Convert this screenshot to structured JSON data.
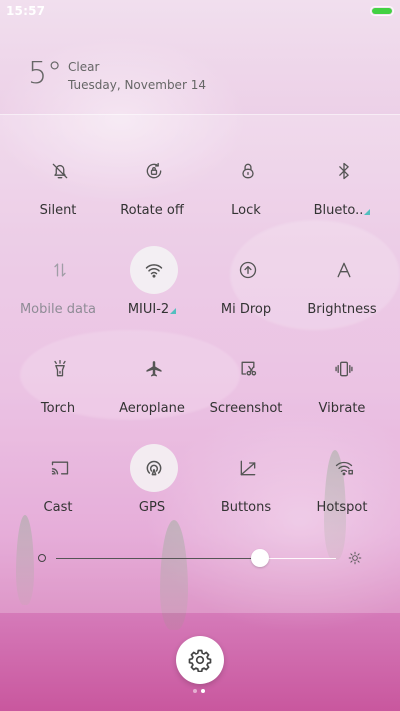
{
  "status_bar": {
    "time": "15:57",
    "battery_level": 1.0,
    "battery_color": "#43d143"
  },
  "weather": {
    "temperature": "5°",
    "condition": "Clear",
    "date": "Tuesday, November 14"
  },
  "tiles": [
    {
      "label": "Silent",
      "icon": "bell-off-icon",
      "active": false,
      "disabled": false
    },
    {
      "label": "Rotate off",
      "icon": "rotate-lock-icon",
      "active": false,
      "disabled": false
    },
    {
      "label": "Lock",
      "icon": "lock-icon",
      "active": false,
      "disabled": false
    },
    {
      "label": "Blueto..",
      "icon": "bluetooth-icon",
      "active": false,
      "disabled": false,
      "has_more": true
    },
    {
      "label": "Mobile data",
      "icon": "mobile-data-icon",
      "active": false,
      "disabled": true
    },
    {
      "label": "MIUI-2",
      "icon": "wifi-icon",
      "active": true,
      "disabled": false,
      "has_more": true
    },
    {
      "label": "Mi Drop",
      "icon": "mi-drop-icon",
      "active": false,
      "disabled": false
    },
    {
      "label": "Brightness",
      "icon": "brightness-auto-icon",
      "active": false,
      "disabled": false
    },
    {
      "label": "Torch",
      "icon": "torch-icon",
      "active": false,
      "disabled": false
    },
    {
      "label": "Aeroplane",
      "icon": "aeroplane-icon",
      "active": false,
      "disabled": false
    },
    {
      "label": "Screenshot",
      "icon": "screenshot-icon",
      "active": false,
      "disabled": false
    },
    {
      "label": "Vibrate",
      "icon": "vibrate-icon",
      "active": false,
      "disabled": false
    },
    {
      "label": "Cast",
      "icon": "cast-icon",
      "active": false,
      "disabled": false
    },
    {
      "label": "GPS",
      "icon": "gps-icon",
      "active": true,
      "disabled": false
    },
    {
      "label": "Buttons",
      "icon": "buttons-icon",
      "active": false,
      "disabled": false
    },
    {
      "label": "Hotspot",
      "icon": "hotspot-icon",
      "active": false,
      "disabled": false
    }
  ],
  "brightness": {
    "level": 0.73
  },
  "pager": {
    "count": 2,
    "active_index": 1
  },
  "colors": {
    "accent_teal": "#53bfbf",
    "active_tile_bg": "#f5f5f5",
    "icon_color": "#555555"
  }
}
